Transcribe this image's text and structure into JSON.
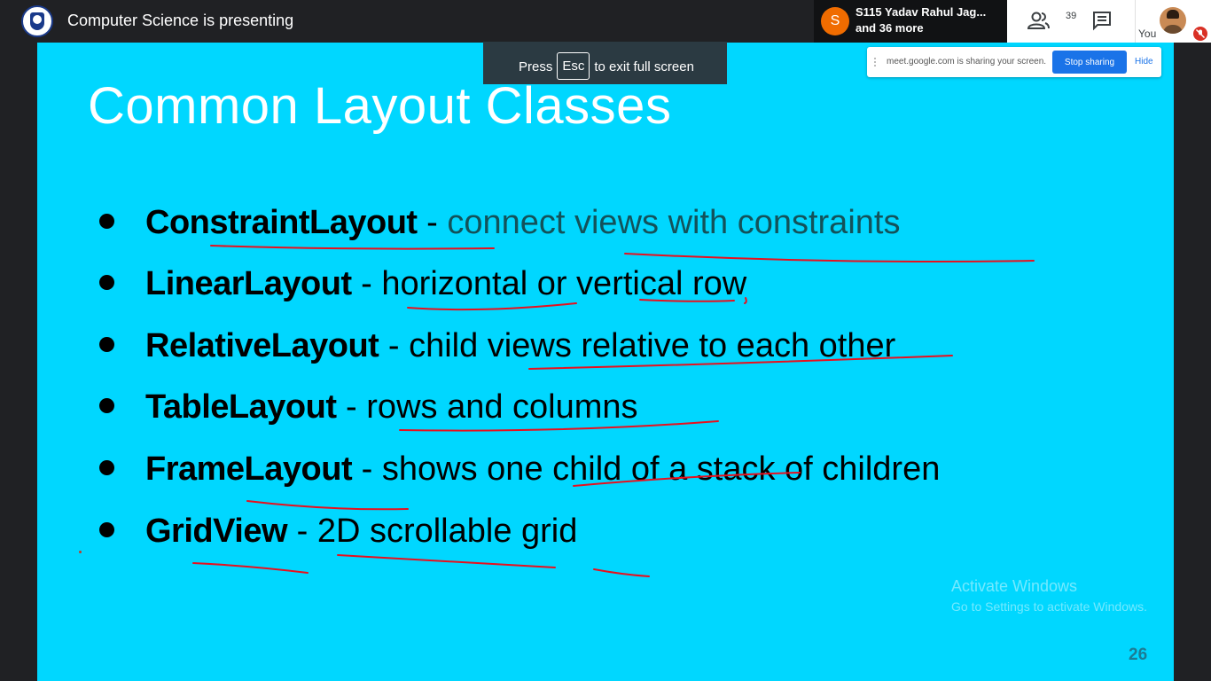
{
  "meet": {
    "presenting_text": "Computer Science is presenting",
    "participant": {
      "initial": "S",
      "name": "S115 Yadav Rahul Jag...",
      "more": "and 36 more"
    },
    "people_count": "39",
    "self_label": "You",
    "icons": [
      "people-icon",
      "chat-icon",
      "mic-off-icon"
    ]
  },
  "fullscreen_hint": {
    "before": "Press",
    "key": "Esc",
    "after": "to exit full screen"
  },
  "share_bar": {
    "message": "meet.google.com is sharing your screen.",
    "stop_label": "Stop sharing",
    "hide_label": "Hide"
  },
  "slide": {
    "title": "Common Layout Classes",
    "items": [
      {
        "term": "ConstraintLayout",
        "sep": " - ",
        "desc": "connect views with constraints"
      },
      {
        "term": "LinearLayout",
        "sep": " - ",
        "desc": "horizontal or vertical row"
      },
      {
        "term": "RelativeLayout",
        "sep": " - ",
        "desc": "child views relative to each other"
      },
      {
        "term": "TableLayout",
        "sep": " - ",
        "desc": "rows and columns"
      },
      {
        "term": "FrameLayout",
        "sep": " - ",
        "desc": "shows one child of a stack of children"
      },
      {
        "term": "GridView",
        "sep": " - ",
        "desc": "2D scrollable grid"
      }
    ],
    "page_number": "26",
    "colors": {
      "background": "#00d7ff",
      "title": "#ffffff",
      "annotation_ink": "#e8101e"
    }
  },
  "watermark": {
    "line1": "Activate Windows",
    "line2": "Go to Settings to activate Windows."
  }
}
